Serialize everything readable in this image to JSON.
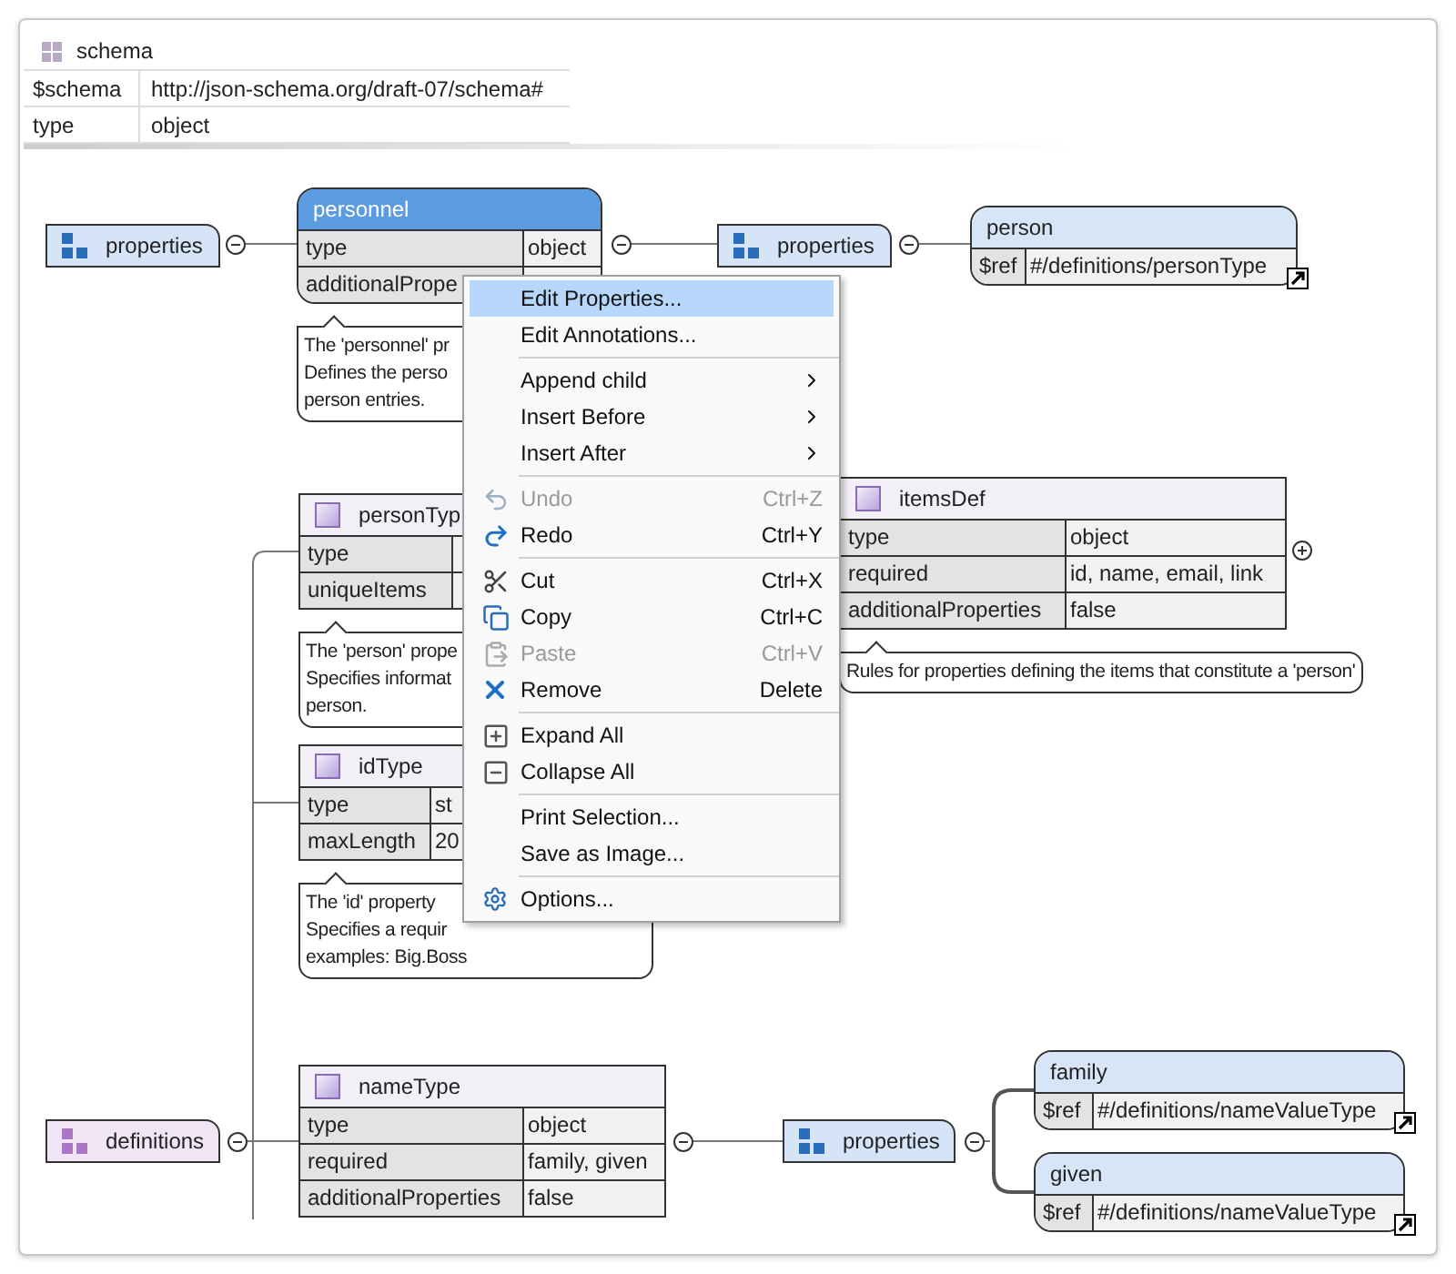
{
  "schema": {
    "title": "schema",
    "rows": [
      {
        "key": "$schema",
        "value": "http://json-schema.org/draft-07/schema#"
      },
      {
        "key": "type",
        "value": "object"
      }
    ]
  },
  "nodes": [
    {
      "kind": "properties",
      "label": "properties",
      "selected": false,
      "expanded": true
    },
    {
      "kind": "property",
      "label": "personnel",
      "selected": true,
      "expanded": true,
      "linked": false,
      "rows": [
        {
          "key": "type",
          "value": "object"
        },
        {
          "key": "additionalPrope",
          "value": ""
        }
      ],
      "comment": [
        "The 'personnel' pr",
        "Defines the perso",
        "person entries."
      ]
    },
    {
      "kind": "properties",
      "label": "properties",
      "selected": false,
      "expanded": true
    },
    {
      "kind": "property",
      "label": "person",
      "selected": false,
      "linked": true,
      "rows": [
        {
          "key": "$ref",
          "value": "#/definitions/personType"
        }
      ]
    },
    {
      "kind": "type",
      "label": "personTyp",
      "selected": false,
      "rows": [
        {
          "key": "type",
          "value": ""
        },
        {
          "key": "uniqueItems",
          "value": ""
        }
      ],
      "comment": [
        "The 'person' prope",
        "Specifies informat",
        "person."
      ]
    },
    {
      "kind": "type",
      "label": "itemsDef",
      "selected": false,
      "expanded": false,
      "rows": [
        {
          "key": "type",
          "value": "object"
        },
        {
          "key": "required",
          "value": "id, name, email, link"
        },
        {
          "key": "additionalProperties",
          "value": "false"
        }
      ],
      "comment": [
        "Rules for properties defining the items that constitute a 'person'"
      ]
    },
    {
      "kind": "type",
      "label": "idType",
      "selected": false,
      "rows": [
        {
          "key": "type",
          "value": "st"
        },
        {
          "key": "maxLength",
          "value": "20"
        }
      ],
      "comment": [
        "The 'id' property",
        "Specifies a requir",
        "examples: Big.Boss"
      ]
    },
    {
      "kind": "definitions",
      "label": "definitions",
      "selected": false,
      "expanded": true
    },
    {
      "kind": "type",
      "label": "nameType",
      "selected": false,
      "expanded": true,
      "rows": [
        {
          "key": "type",
          "value": "object"
        },
        {
          "key": "required",
          "value": "family, given"
        },
        {
          "key": "additionalProperties",
          "value": "false"
        }
      ]
    },
    {
      "kind": "properties",
      "label": "properties",
      "selected": false,
      "expanded": true
    },
    {
      "kind": "property",
      "label": "family",
      "selected": false,
      "linked": true,
      "rows": [
        {
          "key": "$ref",
          "value": "#/definitions/nameValueType"
        }
      ]
    },
    {
      "kind": "property",
      "label": "given",
      "selected": false,
      "linked": true,
      "rows": [
        {
          "key": "$ref",
          "value": "#/definitions/nameValueType"
        }
      ]
    }
  ],
  "context_menu": [
    {
      "kind": "item",
      "label": "Edit Properties...",
      "selected": true,
      "disabled": false,
      "submenu": false
    },
    {
      "kind": "item",
      "label": "Edit Annotations...",
      "selected": false,
      "disabled": false,
      "submenu": false
    },
    {
      "kind": "separator"
    },
    {
      "kind": "item",
      "label": "Append child",
      "selected": false,
      "disabled": false,
      "submenu": true
    },
    {
      "kind": "item",
      "label": "Insert Before",
      "selected": false,
      "disabled": false,
      "submenu": true
    },
    {
      "kind": "item",
      "label": "Insert After",
      "selected": false,
      "disabled": false,
      "submenu": true
    },
    {
      "kind": "separator"
    },
    {
      "kind": "item",
      "label": "Undo",
      "shortcut": "Ctrl+Z",
      "selected": false,
      "disabled": true,
      "submenu": false
    },
    {
      "kind": "item",
      "label": "Redo",
      "shortcut": "Ctrl+Y",
      "selected": false,
      "disabled": false,
      "submenu": false
    },
    {
      "kind": "separator"
    },
    {
      "kind": "item",
      "label": "Cut",
      "shortcut": "Ctrl+X",
      "selected": false,
      "disabled": false,
      "submenu": false
    },
    {
      "kind": "item",
      "label": "Copy",
      "shortcut": "Ctrl+C",
      "selected": false,
      "disabled": false,
      "submenu": false
    },
    {
      "kind": "item",
      "label": "Paste",
      "shortcut": "Ctrl+V",
      "selected": false,
      "disabled": true,
      "submenu": false
    },
    {
      "kind": "item",
      "label": "Remove",
      "shortcut": "Delete",
      "selected": false,
      "disabled": false,
      "submenu": false
    },
    {
      "kind": "separator"
    },
    {
      "kind": "item",
      "label": "Expand All",
      "selected": false,
      "disabled": false,
      "submenu": false
    },
    {
      "kind": "item",
      "label": "Collapse All",
      "selected": false,
      "disabled": false,
      "submenu": false
    },
    {
      "kind": "separator"
    },
    {
      "kind": "item",
      "label": "Print Selection...",
      "selected": false,
      "disabled": false,
      "submenu": false
    },
    {
      "kind": "item",
      "label": "Save as Image...",
      "selected": false,
      "disabled": false,
      "submenu": false
    },
    {
      "kind": "separator"
    },
    {
      "kind": "item",
      "label": "Options...",
      "selected": false,
      "disabled": false,
      "submenu": false
    }
  ]
}
